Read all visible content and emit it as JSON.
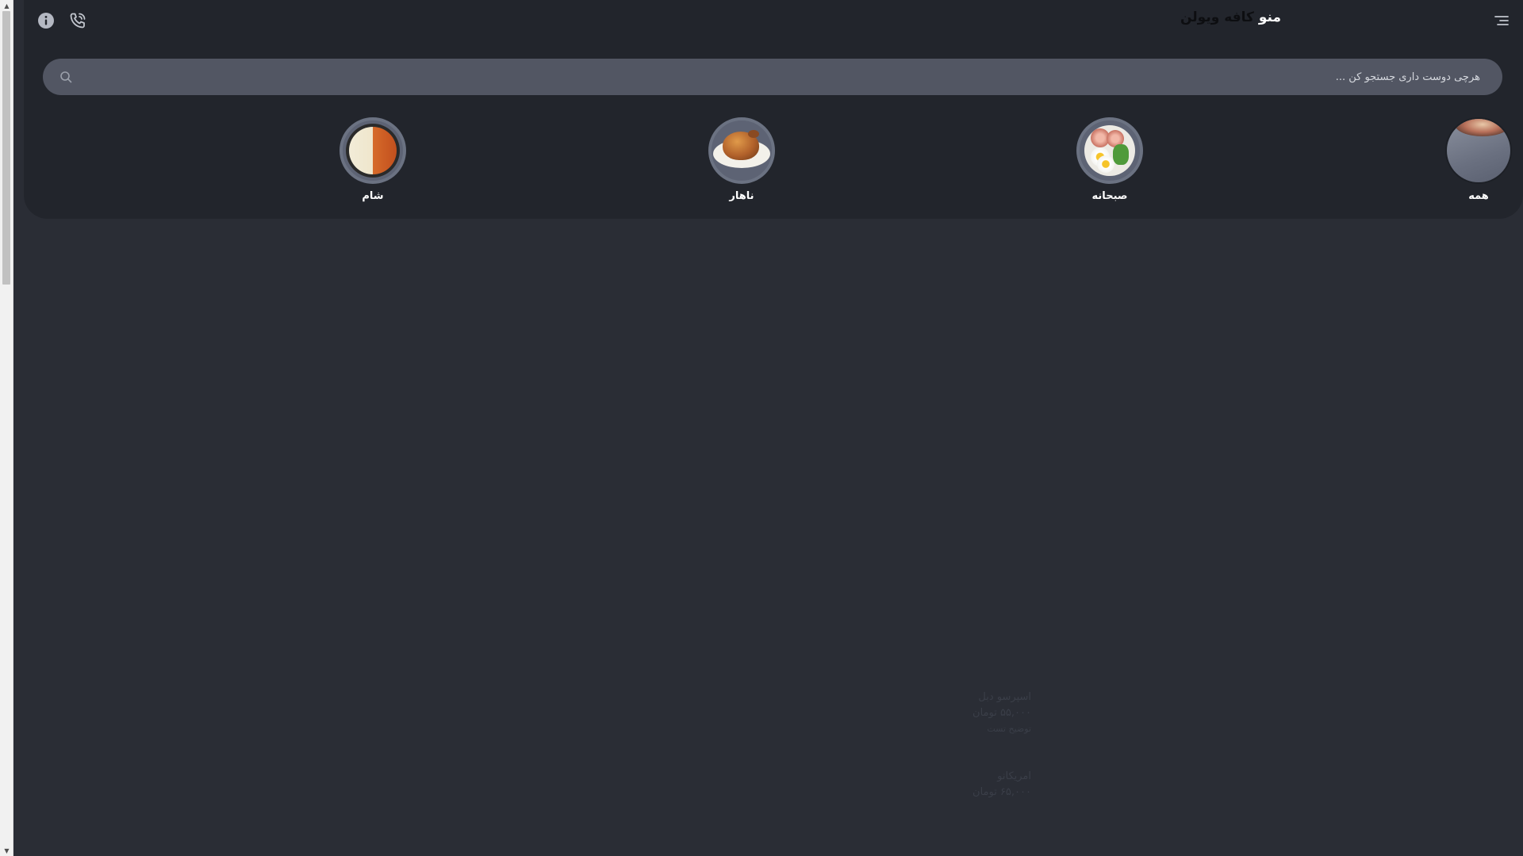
{
  "header": {
    "brand_primary": "منو",
    "brand_secondary": "کافه ویولن"
  },
  "icons": {
    "info": "info-icon",
    "phone": "phone-icon",
    "menu": "menu-icon",
    "search": "search-icon"
  },
  "search": {
    "placeholder": "هرچی دوست داری جستجو کن ..."
  },
  "categories": [
    {
      "label": "همه"
    },
    {
      "label": "صبحانه"
    },
    {
      "label": "ناهار"
    },
    {
      "label": "شام"
    }
  ],
  "menu_items": [
    {
      "name": "اسپرسو دبل",
      "price": "۵۵,۰۰۰ تومان",
      "desc": "توضیح تست"
    },
    {
      "name": "امریکانو",
      "price": "۶۵,۰۰۰ تومان"
    }
  ],
  "colors": {
    "background": "#2a2d35",
    "header_panel": "#22252c",
    "search_bg": "#525663"
  }
}
